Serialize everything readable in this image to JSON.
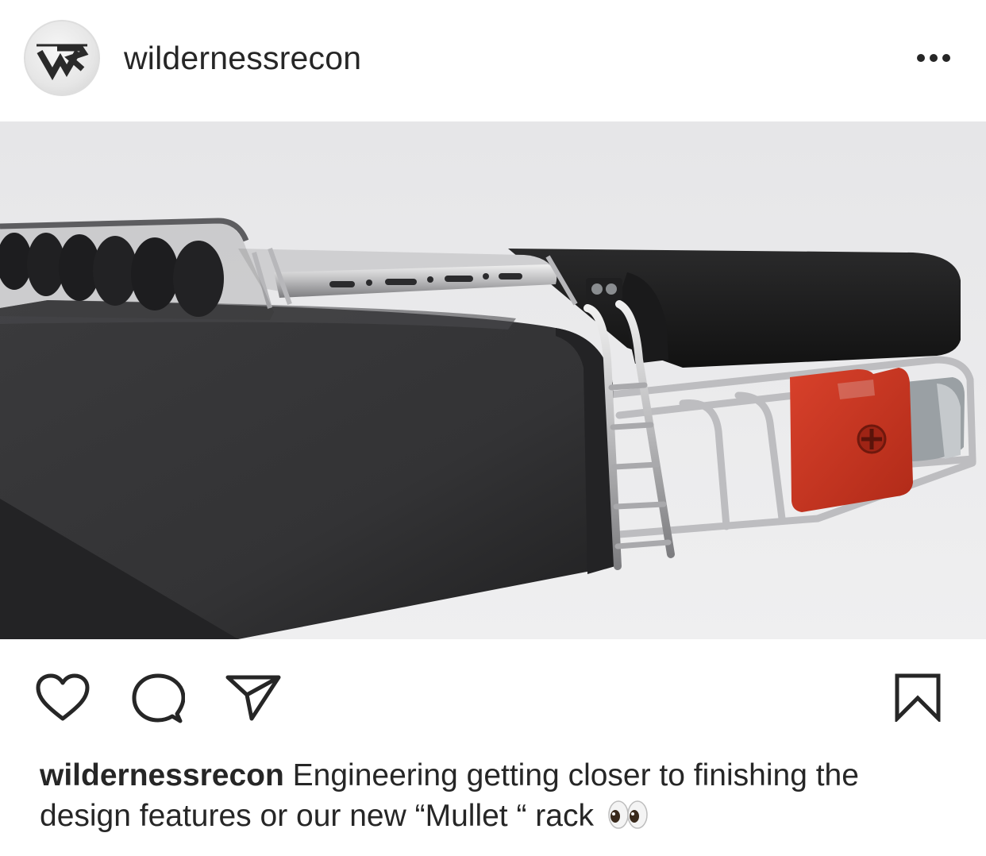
{
  "post": {
    "username": "wildernessrecon",
    "avatar_icon": "wilderness-recon-logo-icon",
    "more_icon": "more-options-icon",
    "image_alt": "3D render of a black truck bed cover with a silver roof rack, light bar, ladder and red fuel can",
    "actions": {
      "like_icon": "heart-icon",
      "comment_icon": "comment-icon",
      "share_icon": "share-icon",
      "save_icon": "bookmark-icon"
    },
    "caption": {
      "username": "wildernessrecon",
      "text": "Engineering getting closer to finishing the design features or our new “Mullet “ rack",
      "emoji_icon": "eyes-emoji-icon"
    }
  },
  "colors": {
    "text": "#262626",
    "jerry_can": "#c9321f",
    "rack": "#c7c7c9",
    "cover": "#2b2b2d"
  }
}
